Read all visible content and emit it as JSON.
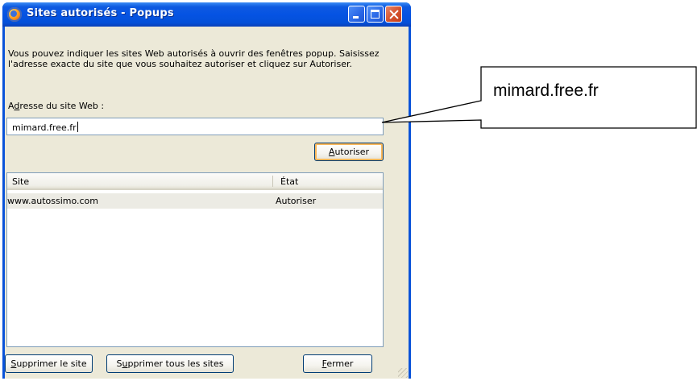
{
  "window": {
    "title": "Sites autorisés - Popups",
    "icon": "firefox-icon",
    "controls": {
      "minimize": "minimize-icon",
      "maximize": "maximize-icon",
      "close": "close-icon"
    }
  },
  "dialog": {
    "description": "Vous pouvez indiquer les sites Web autorisés à ouvrir des fenêtres popup. Saisissez l'adresse exacte du site que vous souhaitez autoriser et cliquez sur Autoriser.",
    "address_label": {
      "accel": "d",
      "pre": "A",
      "post": "resse du site Web :"
    },
    "address_value": "mimard.free.fr",
    "allow_button": {
      "accel": "A",
      "rest": "utoriser"
    },
    "list": {
      "columns": [
        "Site",
        "État"
      ],
      "rows": [
        {
          "site": "www.autossimo.com",
          "status": "Autoriser"
        }
      ]
    },
    "buttons": {
      "remove_site": {
        "accel": "S",
        "rest": "upprimer le site"
      },
      "remove_all": {
        "pre": "S",
        "accel": "u",
        "rest": "pprimer tous les sites"
      },
      "close": {
        "accel": "F",
        "rest": "ermer"
      }
    }
  },
  "callout": {
    "text": "mimard.free.fr"
  },
  "colors": {
    "titlebar": "#0553e3",
    "client": "#ece9d8",
    "close_button": "#d5512b",
    "field_border": "#7f9db9"
  }
}
